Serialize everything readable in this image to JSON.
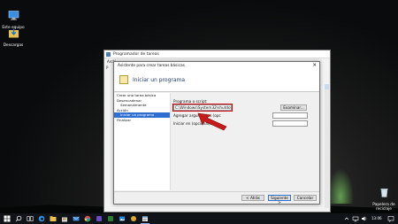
{
  "desktop": {
    "icons": [
      {
        "label": "Este equipo",
        "icon": "computer-icon"
      },
      {
        "label": "Descargas",
        "icon": "downloads-folder-icon"
      },
      {
        "label": "Papelera de reciclaje",
        "icon": "recycle-bin-icon"
      }
    ]
  },
  "back_window": {
    "title": "Programador de tareas",
    "menu": "Archi",
    "side_text": "P"
  },
  "dialog": {
    "title": "Asistente para crear tareas básicas",
    "header_title": "Iniciar un programa",
    "steps": [
      "Crear una tarea básica",
      "Desencadenar",
      "Semanalmente",
      "Acción",
      "Iniciar un programa",
      "Finalizar"
    ],
    "active_step": "Iniciar un programa",
    "program_label": "Programa o script:",
    "program_value": "C:\\Windows\\System32\\shutdown.exe",
    "browse_label": "Examinar...",
    "args_label": "Agregar argumentos (opc",
    "start_label": "Iniciar en (opcional):",
    "back_label": "< Atrás",
    "next_label": "Siguiente >",
    "cancel_label": "Cancelar",
    "close_icon": "close-icon"
  },
  "taskbar": {
    "time": "13:06",
    "icons": [
      "windows-start-icon",
      "search-icon",
      "task-view-icon",
      "edge-icon",
      "file-explorer-icon",
      "store-icon",
      "mail-icon",
      "chrome-icon",
      "app-icon",
      "app-icon",
      "photos-icon",
      "app-icon",
      "task-scheduler-icon"
    ]
  },
  "colors": {
    "accent_selection": "#2e6fd0",
    "highlight_red": "#d50000",
    "taskbar": "#101418"
  }
}
